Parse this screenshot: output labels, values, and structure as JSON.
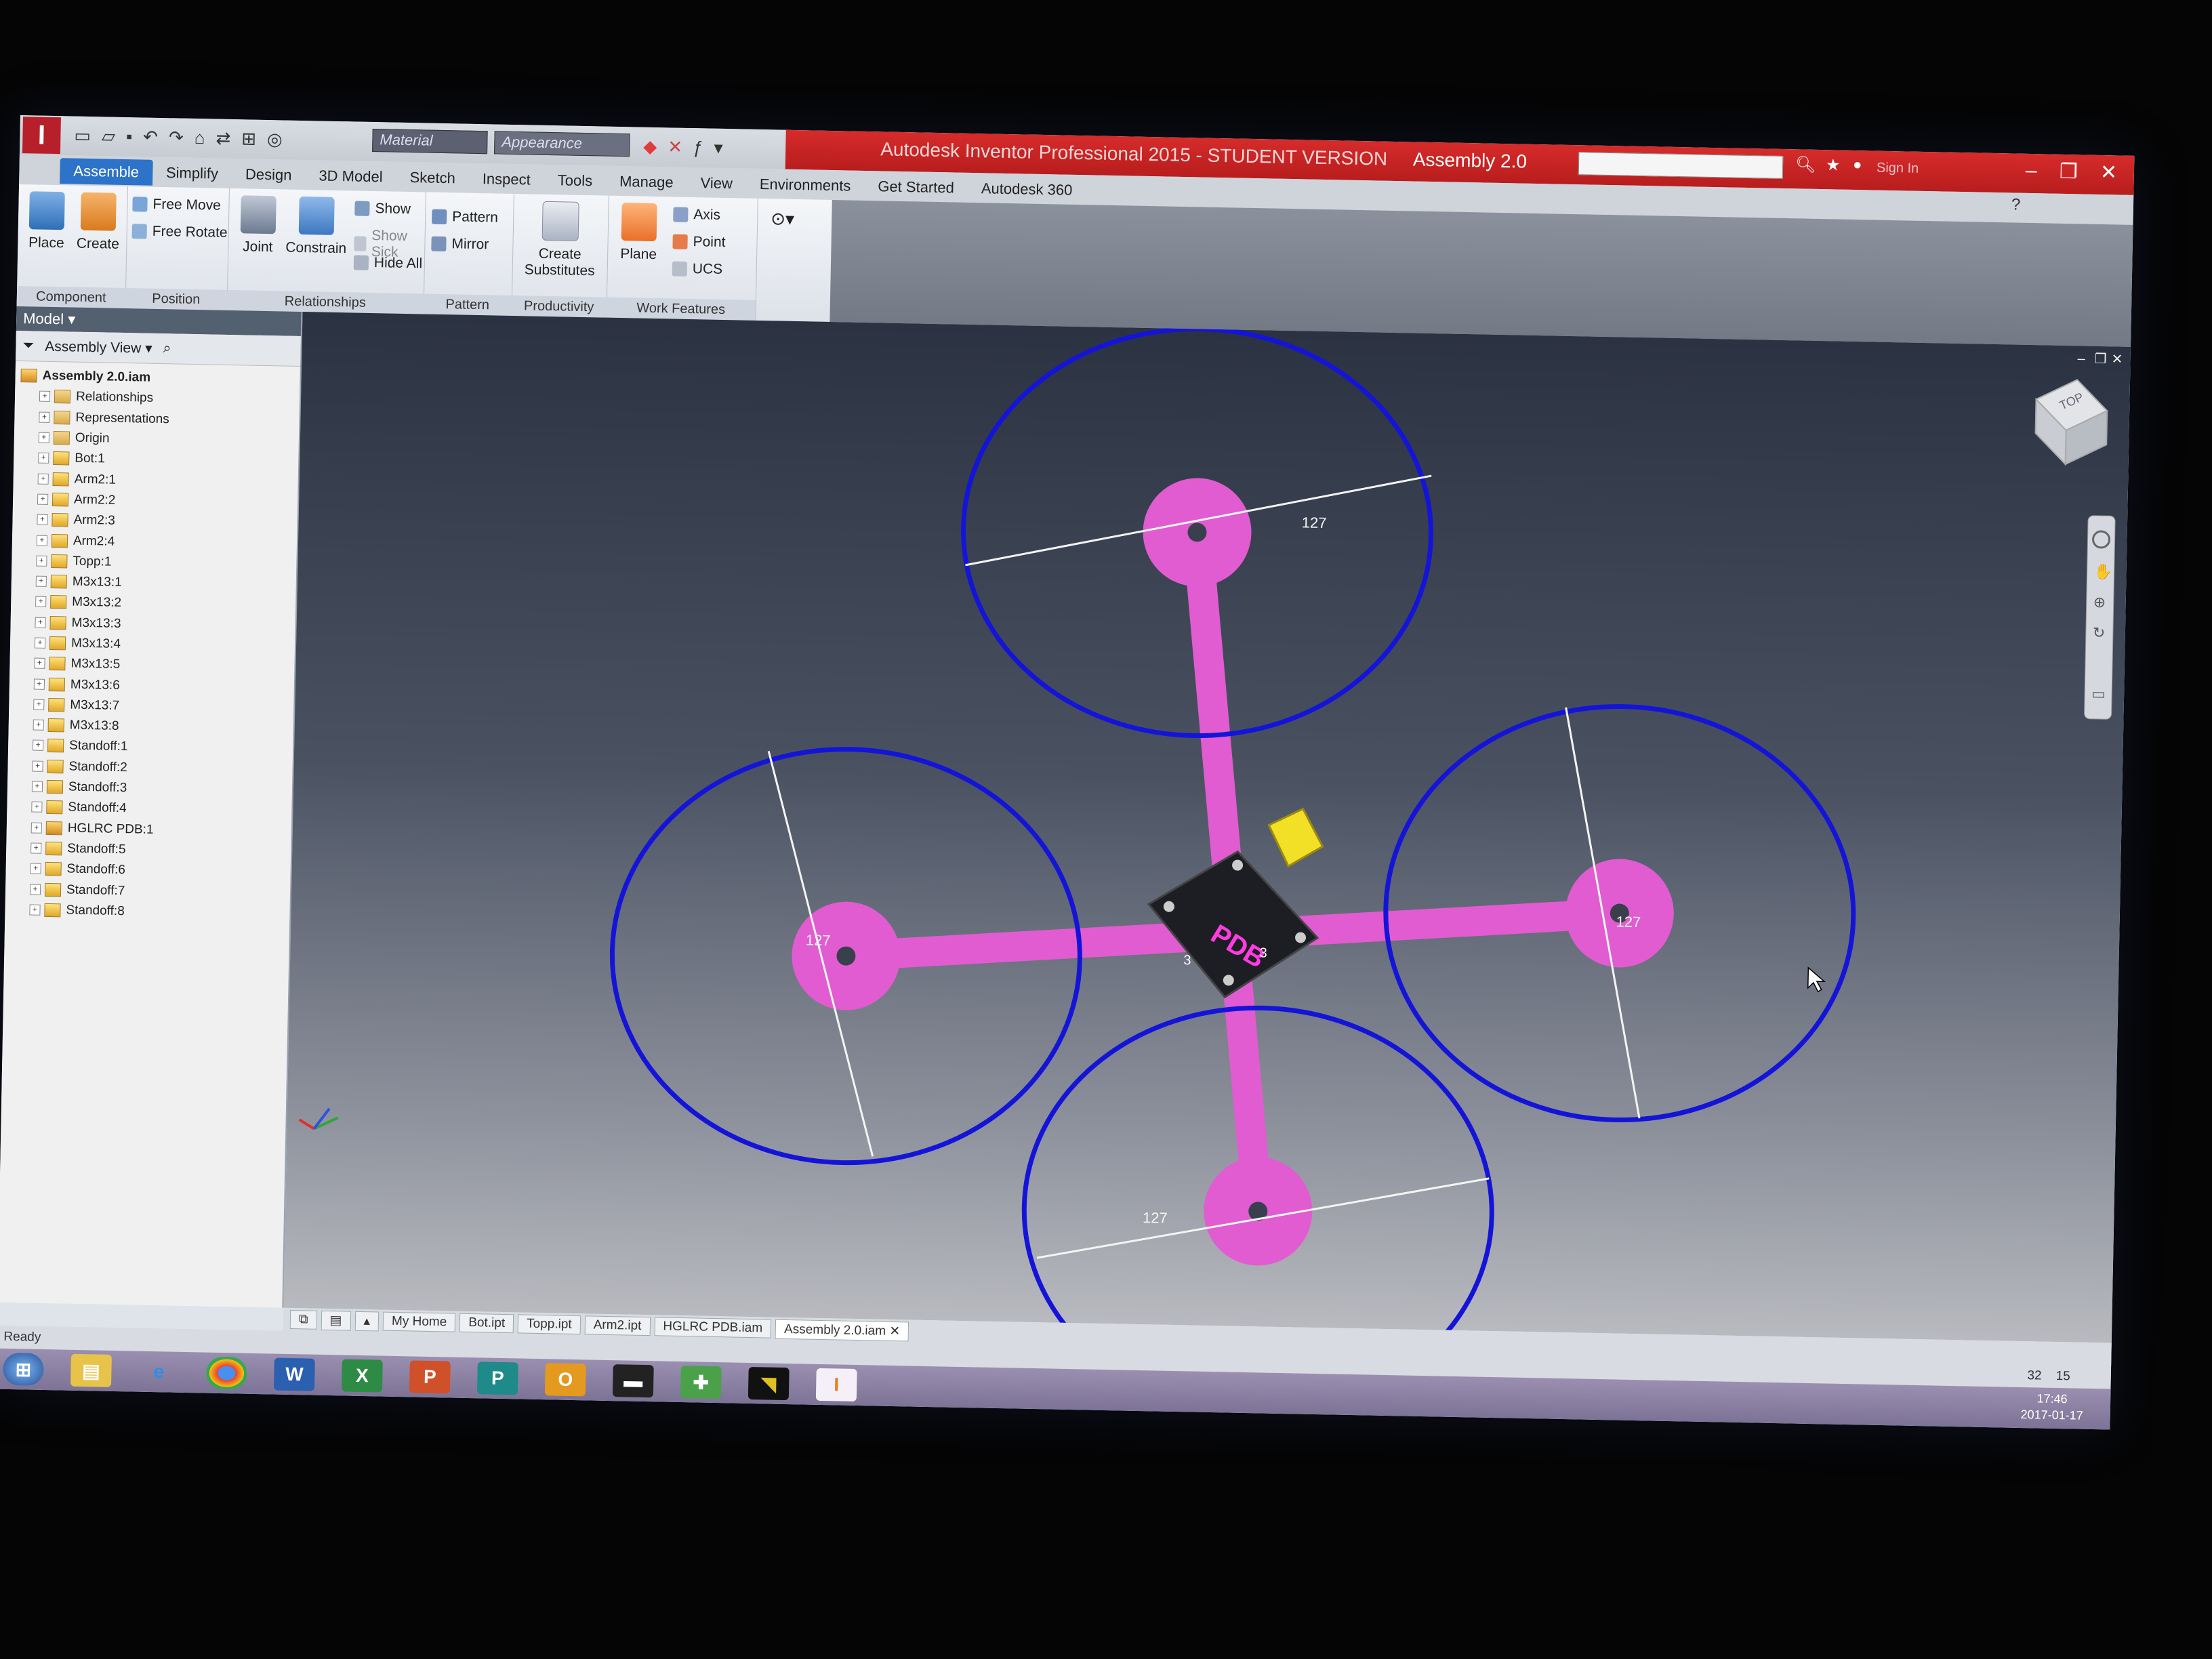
{
  "app": {
    "logo_glyph": "I",
    "title": "Autodesk Inventor Professional 2015 - STUDENT VERSION",
    "document": "Assembly 2.0",
    "material_combo": "Material",
    "appearance_combo": "Appearance",
    "sign_in": "Sign In"
  },
  "tabs": [
    "Assemble",
    "Simplify",
    "Design",
    "3D Model",
    "Sketch",
    "Inspect",
    "Tools",
    "Manage",
    "View",
    "Environments",
    "Get Started",
    "Autodesk 360"
  ],
  "ribbon": {
    "component": {
      "label": "Component",
      "place": "Place",
      "create": "Create"
    },
    "position": {
      "label": "Position",
      "free_move": "Free Move",
      "free_rotate": "Free Rotate"
    },
    "relationships": {
      "label": "Relationships",
      "joint": "Joint",
      "constrain": "Constrain",
      "show": "Show",
      "show_sick": "Show Sick",
      "hide_all": "Hide All"
    },
    "pattern": {
      "label": "Pattern",
      "pattern": "Pattern",
      "mirror": "Mirror"
    },
    "productivity": {
      "label": "Productivity",
      "create_substitutes_1": "Create",
      "create_substitutes_2": "Substitutes"
    },
    "work_features": {
      "label": "Work Features",
      "plane": "Plane",
      "axis": "Axis",
      "point": "Point",
      "ucs": "UCS"
    }
  },
  "browser": {
    "header": "Model",
    "view": "Assembly View",
    "root": "Assembly 2.0.iam",
    "nodes": [
      "Relationships",
      "Representations",
      "Origin",
      "Bot:1",
      "Arm2:1",
      "Arm2:2",
      "Arm2:3",
      "Arm2:4",
      "Topp:1",
      "M3x13:1",
      "M3x13:2",
      "M3x13:3",
      "M3x13:4",
      "M3x13:5",
      "M3x13:6",
      "M3x13:7",
      "M3x13:8",
      "Standoff:1",
      "Standoff:2",
      "Standoff:3",
      "Standoff:4",
      "HGLRC PDB:1",
      "Standoff:5",
      "Standoff:6",
      "Standoff:7",
      "Standoff:8"
    ]
  },
  "viewport": {
    "dimension_value": "127",
    "pdb_label": "PDB",
    "small_dim": "3",
    "viewcube_label": "TOP",
    "frame_color": "#e05cd0",
    "circle_color": "#1414d8"
  },
  "doc_tabs": [
    "My Home",
    "Bot.ipt",
    "Topp.ipt",
    "Arm2.ipt",
    "HGLRC PDB.iam",
    "Assembly 2.0.iam"
  ],
  "status": {
    "text": "Ready",
    "n1": "32",
    "n2": "15"
  },
  "taskbar": {
    "time": "17:46",
    "date": "2017-01-17"
  }
}
